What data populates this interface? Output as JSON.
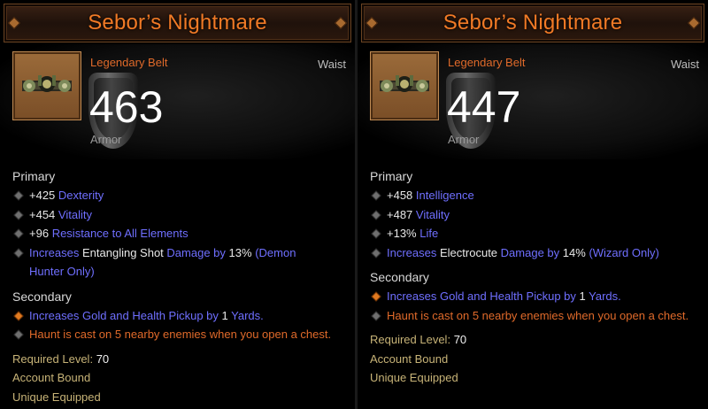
{
  "left": {
    "title": "Sebor’s Nightmare",
    "item_type": "Legendary Belt",
    "slot": "Waist",
    "armor_value": "463",
    "armor_label": "Armor",
    "primary_label": "Primary",
    "primary": [
      {
        "num": "+425",
        "stat": "Dexterity"
      },
      {
        "num": "+454",
        "stat": "Vitality"
      },
      {
        "num": "+96",
        "stat": "Resistance to All Elements"
      }
    ],
    "skill_bonus": {
      "prefix": "Increases",
      "skill": "Entangling Shot",
      "dmg": "Damage by",
      "pct": "13%",
      "class": "(Demon",
      "class2": "Hunter Only)"
    },
    "secondary_label": "Secondary",
    "secondary": [
      {
        "a": "Increases Gold and Health Pickup by",
        "b": "1",
        "c": "Yards."
      },
      {
        "text": "Haunt is cast on 5 nearby enemies when you open a chest."
      }
    ],
    "req_label": "Required Level:",
    "req_value": "70",
    "bound": "Account Bound",
    "unique": "Unique Equipped"
  },
  "right": {
    "title": "Sebor’s Nightmare",
    "item_type": "Legendary Belt",
    "slot": "Waist",
    "armor_value": "447",
    "armor_label": "Armor",
    "primary_label": "Primary",
    "primary": [
      {
        "num": "+458",
        "stat": "Intelligence"
      },
      {
        "num": "+487",
        "stat": "Vitality"
      },
      {
        "num": "+13%",
        "stat": "Life"
      }
    ],
    "skill_bonus": {
      "prefix": "Increases",
      "skill": "Electrocute",
      "dmg": "Damage by",
      "pct": "14%",
      "class": "(Wizard Only)"
    },
    "secondary_label": "Secondary",
    "secondary": [
      {
        "a": "Increases Gold and Health Pickup by",
        "b": "1",
        "c": "Yards."
      },
      {
        "text": "Haunt is cast on 5 nearby enemies when you open a chest."
      }
    ],
    "req_label": "Required Level:",
    "req_value": "70",
    "bound": "Account Bound",
    "unique": "Unique Equipped"
  },
  "colors": {
    "title": "#f07a26",
    "blue_stat": "#6f6fff",
    "legendary": "#e06a2a",
    "footer": "#c7b377"
  },
  "icons": {
    "item": "belt-icon",
    "armor": "shield-icon",
    "bullet": "diamond-bullet-icon"
  }
}
